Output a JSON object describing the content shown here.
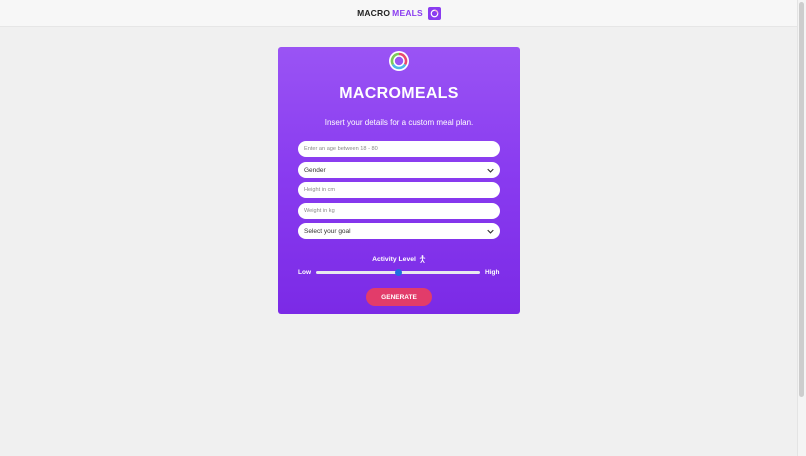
{
  "header": {
    "brand_macro": "MACRO",
    "brand_meals": "MEALS"
  },
  "card": {
    "title": "MACROMEALS",
    "subtitle": "Insert your details for a custom meal plan.",
    "age_placeholder": "Enter an age between 18 - 80",
    "gender_selected": "Gender",
    "height_placeholder": "Height in cm",
    "weight_placeholder": "Weight in kg",
    "goal_selected": "Select your goal",
    "activity_label": "Activity Level",
    "slider_low": "Low",
    "slider_high": "High",
    "slider_value_fraction": 0.5,
    "generate_label": "GENERATE"
  },
  "colors": {
    "accent": "#8a3cf0",
    "card_top": "#9a54f4",
    "card_bottom": "#7b2ae6",
    "button": "#e23c6a",
    "slider_thumb": "#1f6fe0"
  },
  "icons": {
    "brand_logo": "pie-chart-icon",
    "card_logo": "donut-chart-icon",
    "select_arrow": "chevron-down-icon",
    "activity": "running-person-icon"
  }
}
